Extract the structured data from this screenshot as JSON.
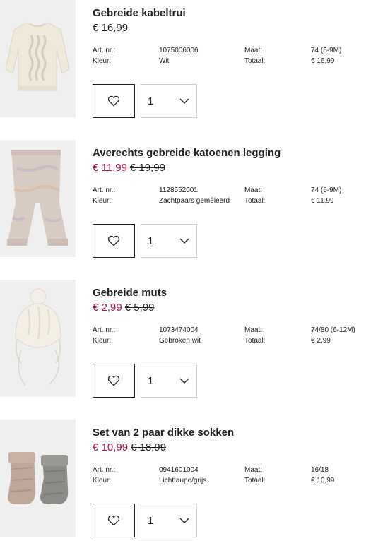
{
  "items": [
    {
      "name": "Gebreide kabeltrui",
      "price": "€ 16,99",
      "sale": false,
      "old_price": "",
      "art_label": "Art. nr.:",
      "art_no": "1075006006",
      "color_label": "Kleur:",
      "color": "Wit",
      "size_label": "Maat:",
      "size": "74 (6-9M)",
      "total_label": "Totaal:",
      "total": "€ 16,99",
      "quantity": "1",
      "icon": "sweater-icon"
    },
    {
      "name": "Averechts gebreide katoenen legging",
      "price": "€ 11,99",
      "sale": true,
      "old_price": "€ 19,99",
      "art_label": "Art. nr.:",
      "art_no": "1128552001",
      "color_label": "Kleur:",
      "color": "Zachtpaars gemêleerd",
      "size_label": "Maat:",
      "size": "74 (6-9M)",
      "total_label": "Totaal:",
      "total": "€ 11,99",
      "quantity": "1",
      "icon": "leggings-icon"
    },
    {
      "name": "Gebreide muts",
      "price": "€ 2,99",
      "sale": true,
      "old_price": "€ 5,99",
      "art_label": "Art. nr.:",
      "art_no": "1073474004",
      "color_label": "Kleur:",
      "color": "Gebroken wit",
      "size_label": "Maat:",
      "size": "74/80 (6-12M)",
      "total_label": "Totaal:",
      "total": "€ 2,99",
      "quantity": "1",
      "icon": "hat-icon"
    },
    {
      "name": "Set van 2 paar dikke sokken",
      "price": "€ 10,99",
      "sale": true,
      "old_price": "€ 18,99",
      "art_label": "Art. nr.:",
      "art_no": "0941601004",
      "color_label": "Kleur:",
      "color": "Lichttaupe/grijs",
      "size_label": "Maat:",
      "size": "16/18",
      "total_label": "Totaal:",
      "total": "€ 10,99",
      "quantity": "1",
      "icon": "socks-icon"
    }
  ],
  "colors": {
    "sale": "#b0123f",
    "text": "#222222",
    "thumb_bg": "#efefef"
  }
}
